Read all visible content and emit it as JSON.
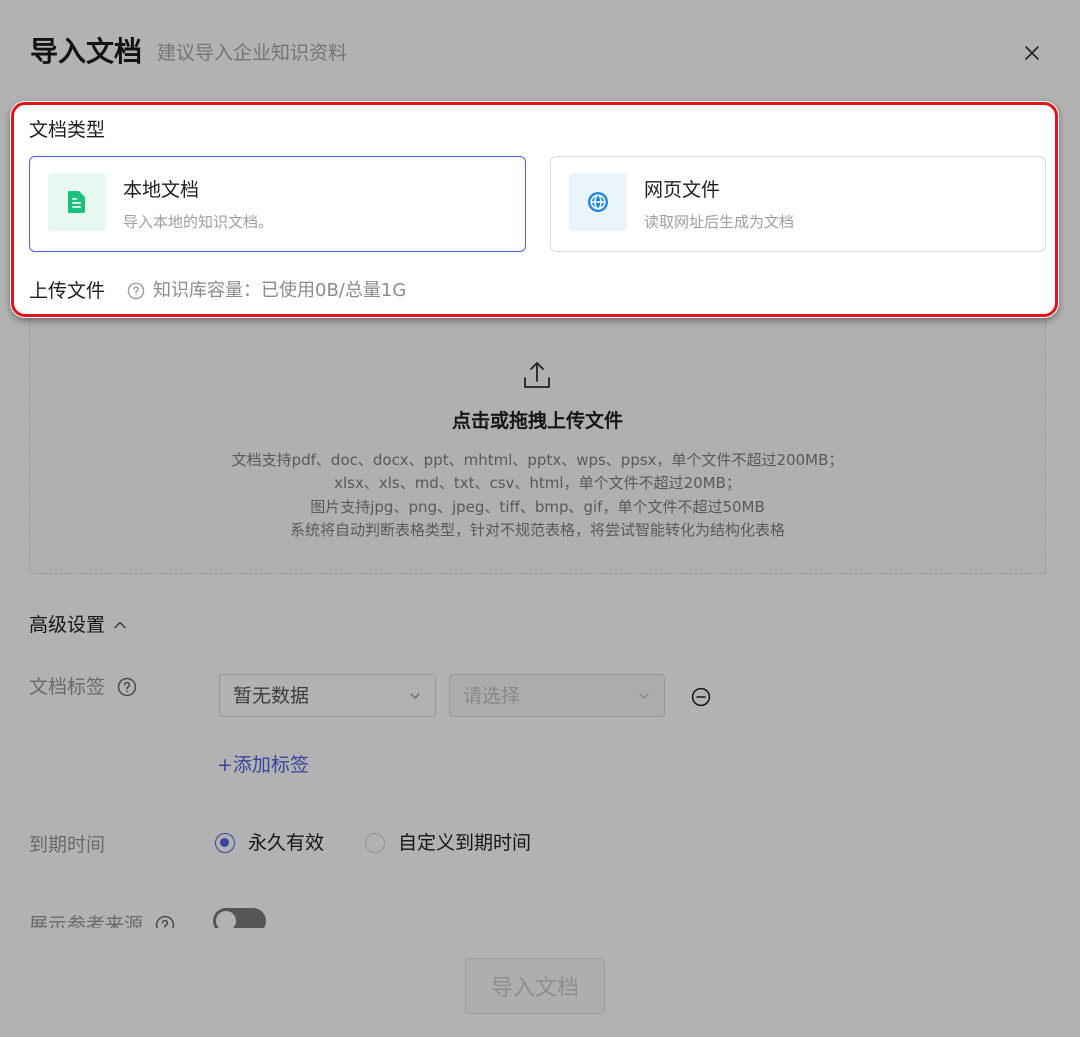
{
  "dialog": {
    "title": "导入文档",
    "subtitle": "建议导入企业知识资料",
    "close_icon": "close-icon"
  },
  "doc_type": {
    "label": "文档类型",
    "options": [
      {
        "title": "本地文档",
        "desc": "导入本地的知识文档。",
        "icon": "document-icon",
        "selected": true
      },
      {
        "title": "网页文件",
        "desc": "读取网址后生成为文档",
        "icon": "globe-icon",
        "selected": false
      }
    ]
  },
  "upload": {
    "label": "上传文件",
    "help_icon": "question-circle-icon",
    "capacity": "知识库容量：已使用0B/总量1G",
    "dropzone": {
      "icon": "upload-icon",
      "title": "点击或拖拽上传文件",
      "lines": [
        "文档支持pdf、doc、docx、ppt、mhtml、pptx、wps、ppsx，单个文件不超过200MB；",
        "xlsx、xls、md、txt、csv、html，单个文件不超过20MB；",
        "图片支持jpg、png、jpeg、tiff、bmp、gif，单个文件不超过50MB",
        "系统将自动判断表格类型，针对不规范表格，将尝试智能转化为结构化表格"
      ]
    }
  },
  "advanced": {
    "title": "高级设置",
    "expanded": true,
    "toggle_icon": "chevron-up-icon",
    "tags": {
      "label": "文档标签",
      "help_icon": "question-circle-icon",
      "tag_value": "暂无数据",
      "value_placeholder": "请选择",
      "remove_icon": "minus-circle-icon",
      "add_label": "+添加标签"
    },
    "expiry": {
      "label": "到期时间",
      "options": [
        "永久有效",
        "自定义到期时间"
      ],
      "selected_index": 0
    },
    "show_source": {
      "label": "展示参考来源",
      "help_icon": "question-circle-icon",
      "enabled": false
    }
  },
  "footer": {
    "submit_label": "导入文档",
    "submit_disabled": true
  },
  "colors": {
    "accent": "#4f63e6",
    "highlight": "#e0141b",
    "doc_icon": "#19c37d",
    "doc_icon_bg": "#e6f8f0",
    "globe_icon": "#1e88e5",
    "globe_icon_bg": "#e9f4fd"
  }
}
